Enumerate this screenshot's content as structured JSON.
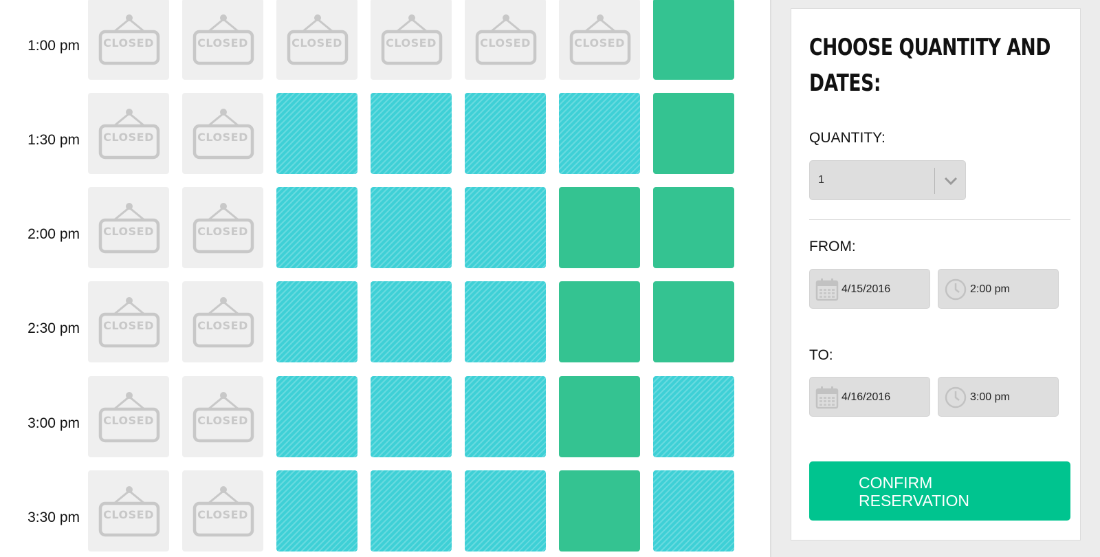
{
  "schedule": {
    "times": [
      "1:00 pm",
      "1:30 pm",
      "2:00 pm",
      "2:30 pm",
      "3:00 pm",
      "3:30 pm"
    ],
    "closed_label": "CLOSED",
    "slot_states": [
      [
        "closed",
        "closed",
        "closed",
        "closed",
        "closed",
        "closed",
        "available"
      ],
      [
        "closed",
        "closed",
        "booked",
        "booked",
        "booked",
        "booked",
        "available"
      ],
      [
        "closed",
        "closed",
        "booked",
        "booked",
        "booked",
        "available",
        "available"
      ],
      [
        "closed",
        "closed",
        "booked",
        "booked",
        "booked",
        "available",
        "available"
      ],
      [
        "closed",
        "closed",
        "booked",
        "booked",
        "booked",
        "available",
        "booked"
      ],
      [
        "closed",
        "closed",
        "booked",
        "booked",
        "booked",
        "available",
        "booked"
      ]
    ],
    "colors": {
      "closed": "#efefef",
      "available": "#34c391",
      "booked": "#3ed0d6"
    }
  },
  "panel": {
    "heading_line1": "Choose quantity and",
    "heading_line2": "dates:",
    "quantity_label": "QUANTITY:",
    "quantity_value": "1",
    "from_label": "FROM:",
    "from_date": "4/15/2016",
    "from_time": "2:00 pm",
    "to_label": "TO:",
    "to_date": "4/16/2016",
    "to_time": "3:00 pm",
    "confirm_line1": "Confirm",
    "confirm_line2": "Reservation",
    "accent_color": "#00c48f",
    "icons": {
      "date": "calendar-icon",
      "time": "clock-icon",
      "select": "chevron-down-icon"
    }
  }
}
